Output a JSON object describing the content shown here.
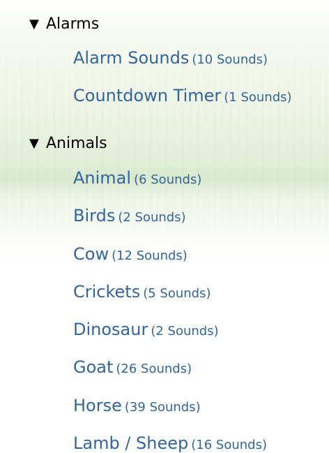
{
  "categories": [
    {
      "label": "Alarms",
      "icon": "triangle-down-icon",
      "expanded": true,
      "items": [
        {
          "name": "Alarm Sounds",
          "count": "(10 Sounds)"
        },
        {
          "name": "Countdown Timer",
          "count": "(1 Sounds)"
        }
      ]
    },
    {
      "label": "Animals",
      "icon": "triangle-down-icon",
      "expanded": true,
      "items": [
        {
          "name": "Animal",
          "count": "(6 Sounds)"
        },
        {
          "name": "Birds",
          "count": "(2 Sounds)"
        },
        {
          "name": "Cow",
          "count": "(12 Sounds)"
        },
        {
          "name": "Crickets",
          "count": "(5 Sounds)"
        },
        {
          "name": "Dinosaur",
          "count": "(2 Sounds)"
        },
        {
          "name": "Goat",
          "count": "(26 Sounds)"
        },
        {
          "name": "Horse",
          "count": "(39 Sounds)"
        },
        {
          "name": "Lamb / Sheep",
          "count": "(16 Sounds)"
        }
      ]
    }
  ],
  "colors": {
    "link": "#34659a",
    "category_text": "#000000",
    "background_tint": "#dcecd2"
  }
}
